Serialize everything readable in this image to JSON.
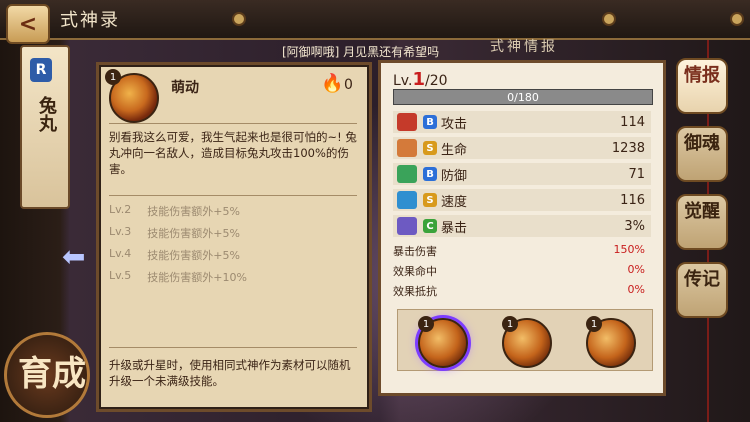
{
  "header": {
    "back_label": "<",
    "title": "式神录"
  },
  "shikigami": {
    "rarity": "R",
    "name": "兔丸"
  },
  "growth_button": {
    "label": "育成"
  },
  "marquee": {
    "text": "[阿御啊哦] 月见黑还有希望吗"
  },
  "info_header": "式神情报",
  "skill": {
    "level_badge": "1",
    "name": "萌动",
    "cost": "0",
    "description": "别看我这么可爱，我生气起来也是很可怕的~! 兔丸冲向一名敌人，造成目标兔丸攻击100%的伤害。",
    "upgrades": [
      {
        "level": "Lv.2",
        "text": "技能伤害额外+5%"
      },
      {
        "level": "Lv.3",
        "text": "技能伤害额外+5%"
      },
      {
        "level": "Lv.4",
        "text": "技能伤害额外+5%"
      },
      {
        "level": "Lv.5",
        "text": "技能伤害额外+10%"
      }
    ],
    "footer": "升级或升星时，使用相同式神作为素材可以随机升级一个未满级技能。"
  },
  "stats": {
    "level_prefix": "Lv.",
    "level_current": "1",
    "level_max": "/20",
    "exp_text": "0/180",
    "exp_fraction": 0,
    "rows": [
      {
        "grade": "B",
        "grade_color": "#2c6fd8",
        "label": "攻击",
        "value": "114"
      },
      {
        "grade": "S",
        "grade_color": "#d89a1c",
        "label": "生命",
        "value": "1238"
      },
      {
        "grade": "B",
        "grade_color": "#2c6fd8",
        "label": "防御",
        "value": "71"
      },
      {
        "grade": "S",
        "grade_color": "#d89a1c",
        "label": "速度",
        "value": "116"
      },
      {
        "grade": "C",
        "grade_color": "#3aa33a",
        "label": "暴击",
        "value": "3%"
      }
    ],
    "subrows": [
      {
        "label": "暴击伤害",
        "value": "150%"
      },
      {
        "label": "效果命中",
        "value": "0%"
      },
      {
        "label": "效果抵抗",
        "value": "0%"
      }
    ],
    "skill_slots": [
      {
        "badge": "1"
      },
      {
        "badge": "1"
      },
      {
        "badge": "1"
      }
    ]
  },
  "tabs": [
    {
      "label": "情报"
    },
    {
      "label": "御魂"
    },
    {
      "label": "觉醒"
    },
    {
      "label": "传记"
    }
  ]
}
